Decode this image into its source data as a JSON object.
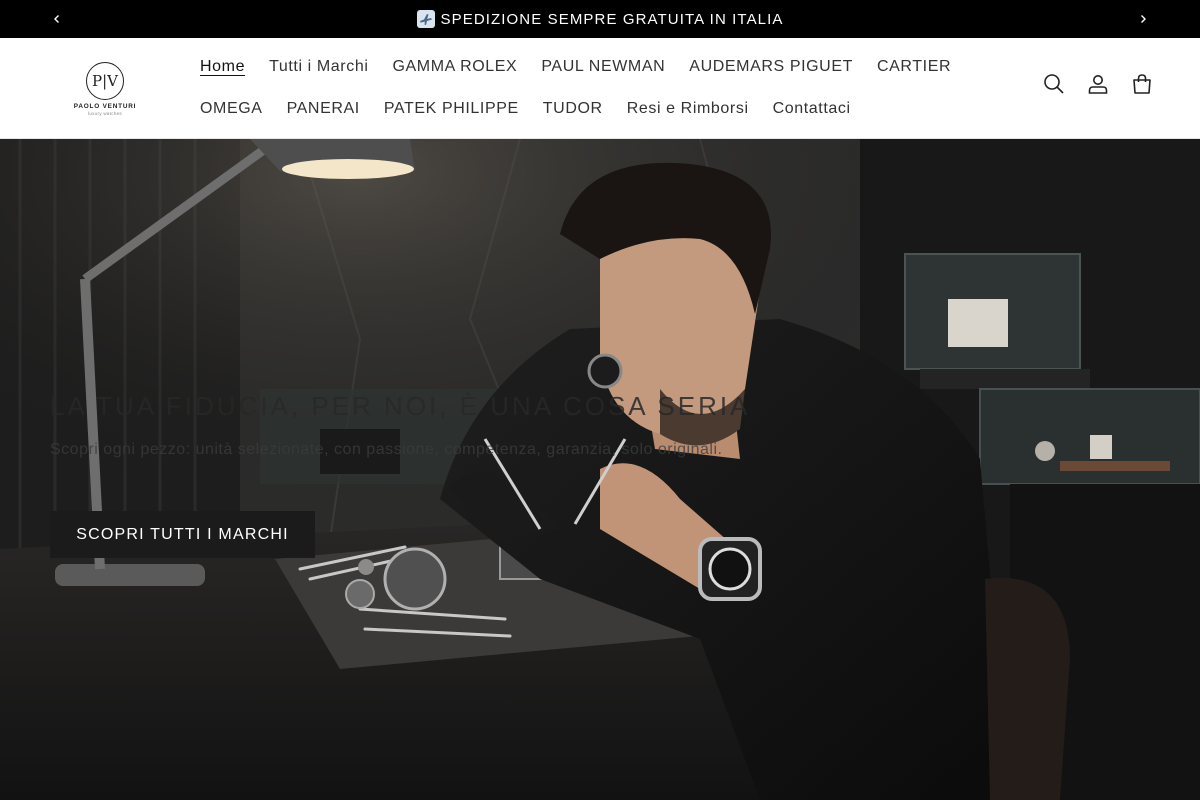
{
  "announcement": {
    "text": "SPEDIZIONE SEMPRE GRATUITA IN ITALIA",
    "icon": "airplane-icon",
    "prev_icon": "chevron-left-icon",
    "next_icon": "chevron-right-icon"
  },
  "logo": {
    "monogram": "P|V",
    "brand": "PAOLO VENTURI",
    "tagline": "luxury watches"
  },
  "nav": {
    "row1": [
      "Home",
      "Tutti i Marchi",
      "GAMMA ROLEX",
      "PAUL NEWMAN",
      "AUDEMARS PIGUET",
      "CARTIER"
    ],
    "row2": [
      "OMEGA",
      "PANERAI",
      "PATEK PHILIPPE",
      "TUDOR",
      "Resi e Rimborsi",
      "Contattaci"
    ],
    "active": "Home"
  },
  "header_icons": [
    "search-icon",
    "account-icon",
    "cart-icon"
  ],
  "hero": {
    "title": "LA TUA FIDUCIA, PER NOI, È UNA COSA SERIA",
    "subtitle": "Scopri ogni pezzo: unità selezionate, con passione, competenza, garanzia, solo originali.",
    "button": "SCOPRI TUTTI I MARCHI"
  },
  "colors": {
    "announcement_bg": "#000000",
    "header_bg": "#ffffff",
    "button_bg": "#1b1b1b"
  }
}
